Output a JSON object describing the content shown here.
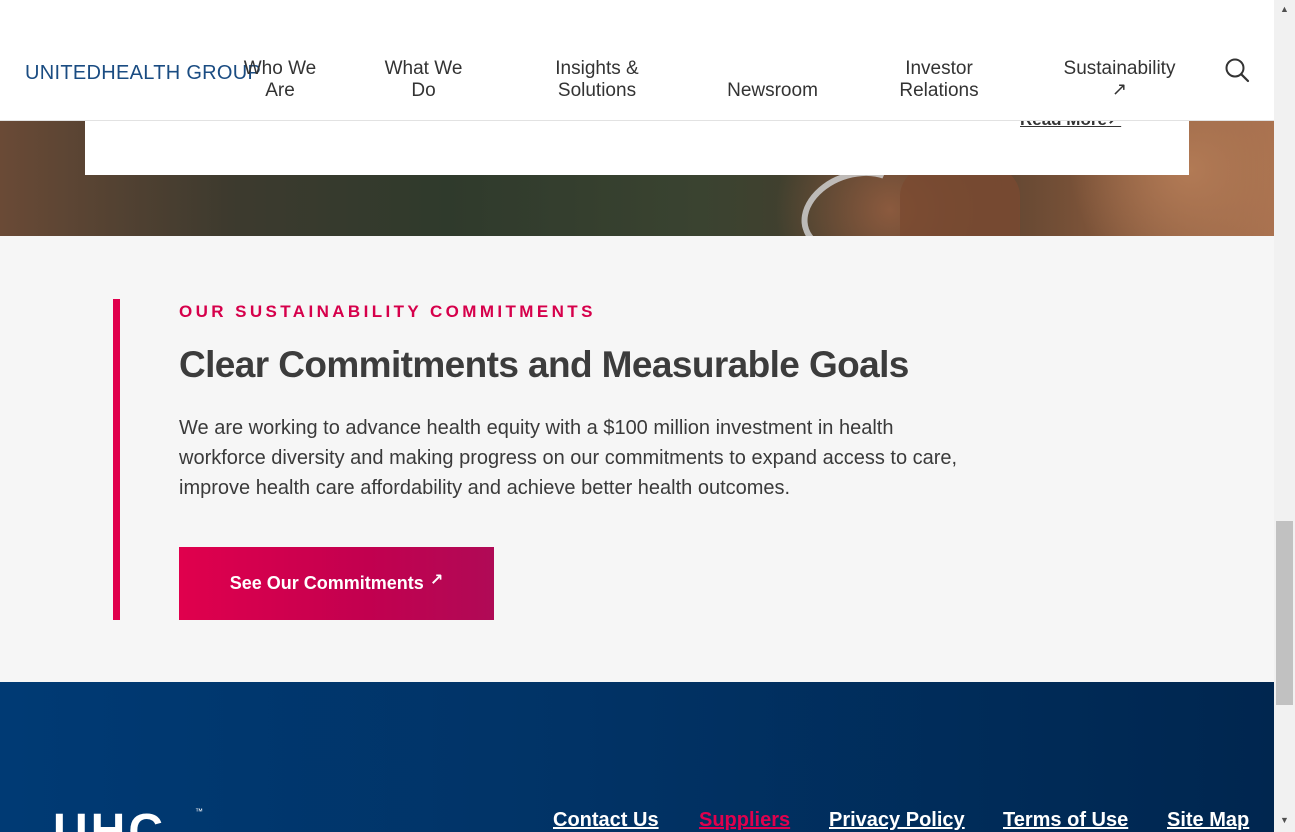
{
  "header": {
    "logo": "UNITEDHEALTH GROUP",
    "nav": [
      {
        "line1": "Who We",
        "line2": "Are"
      },
      {
        "line1": "What We",
        "line2": "Do"
      },
      {
        "line1": "Insights &",
        "line2": "Solutions"
      },
      {
        "line1": "",
        "line2": "Newsroom"
      },
      {
        "line1": "Investor",
        "line2": "Relations"
      },
      {
        "line1": "Sustainability",
        "line2": "↗"
      }
    ],
    "search_icon": "search-icon"
  },
  "hero_card": {
    "read_more": "Read More",
    "read_more_icon": "↗"
  },
  "commitments": {
    "eyebrow": "OUR SUSTAINABILITY COMMITMENTS",
    "title": "Clear Commitments and Measurable Goals",
    "body": "We are working to advance health equity with a $100 million investment in health workforce diversity and making progress on our commitments to expand access to care, improve health care affordability and achieve better health outcomes.",
    "cta_label": "See Our Commitments",
    "cta_icon": "↗",
    "accent_color": "#e0004d"
  },
  "footer": {
    "logo": "UHC",
    "tm": "™",
    "links": [
      "Contact Us",
      "Suppliers",
      "Privacy Policy",
      "Terms of Use",
      "Site Map"
    ],
    "active_link_color": "#e0004d",
    "background_color": "#003a74"
  },
  "scrollbar": {
    "up": "▲",
    "down": "▼"
  }
}
